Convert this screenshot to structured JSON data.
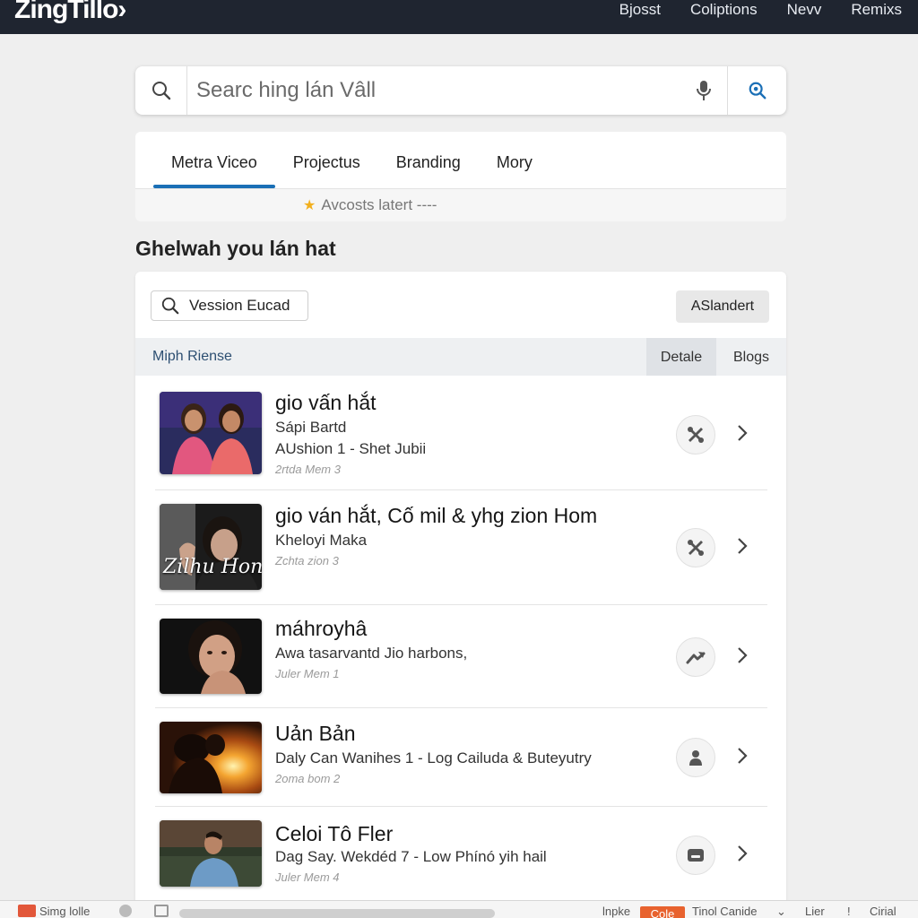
{
  "app": {
    "logo": "ZingTillo›",
    "nav": [
      "Bjosst",
      "Coliptions",
      "Nevv",
      "Remixs"
    ]
  },
  "search": {
    "placeholder": "Searc hing lán Vâll"
  },
  "tabs": [
    {
      "label": "Metra Viceo",
      "active": true
    },
    {
      "label": "Projectus",
      "active": false
    },
    {
      "label": "Branding",
      "active": false
    },
    {
      "label": "Mory",
      "active": false
    }
  ],
  "subline": "Avcosts latert ----",
  "section_title": "Ghelwah you lán hat",
  "filter": {
    "placeholder": "Vession Eucad",
    "button": "ASlandert"
  },
  "list_header": {
    "label": "Miph Riense",
    "tabs": [
      {
        "label": "Detale",
        "active": true
      },
      {
        "label": "Blogs",
        "active": false
      }
    ]
  },
  "items": [
    {
      "title": "gio vấn hắt",
      "subtitle": "Sápi Bartd",
      "line2": "AUshion 1 - Shet Jubii",
      "meta": "2rtda Mem 3",
      "icon": "tools-icon"
    },
    {
      "title": "gio ván hắt, Cố mil & yhg zion Hom",
      "subtitle": "Kheloyi Maka",
      "line2": "",
      "meta": "Zchta zion 3",
      "icon": "tools-icon"
    },
    {
      "title": "máhroyhâ",
      "subtitle": "Awa tasarvantd Jio harbons,",
      "line2": "",
      "meta": "Juler Mem 1",
      "icon": "share-icon"
    },
    {
      "title": "Uản Bản",
      "subtitle": "Daly Can Wanihes 1 - Log Cailuda & Buteyutry",
      "line2": "",
      "meta": "2oma bom 2",
      "icon": "person-icon"
    },
    {
      "title": "Celoi Tô Fler",
      "subtitle": "Dag Say. Wekdéd 7 - Low Phínó yih hail",
      "line2": "",
      "meta": "Juler Mem 4",
      "icon": "inbox-icon"
    }
  ],
  "thumbnail_overlay_text": "Zilhu Hon",
  "taskbar": {
    "app": "Simg lolle",
    "inbox": "lnpke",
    "badge": "Cole",
    "tip": "Tinol Canide",
    "lier": "Lier",
    "excl": "!",
    "cirial": "Cirial"
  },
  "colors": {
    "topbar": "#1f2530",
    "accent": "#1a6fb6",
    "badge": "#e8622e"
  }
}
